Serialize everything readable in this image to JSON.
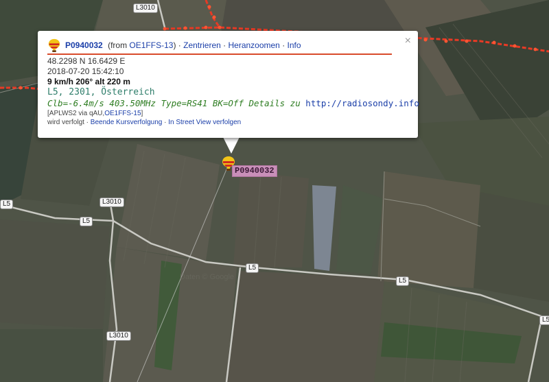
{
  "map": {
    "road_labels": [
      "L3010",
      "L5",
      "L3010",
      "L5",
      "L5",
      "L5",
      "L3010",
      "L5",
      "L5"
    ],
    "watermark": "Daten © Google"
  },
  "marker": {
    "label": "P0940032"
  },
  "popup": {
    "callsign": "P0940032",
    "from_prefix": " (from ",
    "from_call": "OE1FFS-13",
    "from_suffix": ")",
    "sep": " · ",
    "links": [
      "Zentrieren",
      "Heranzoomen",
      "Info"
    ],
    "coords": "48.2298 N 16.6429 E",
    "timestamp": "2018-07-20 15:42:10",
    "speed": "9 km/h 206° alt 220 m",
    "location": "L5, 2301, Österreich",
    "comment_text": "Clb=-6.4m/s 403.50MHz Type=RS41 BK=Off Details zu ",
    "comment_url": "http://radiosondy.info",
    "path_prefix": "[APLWS2 via qAU,",
    "path_call": "OE1FFS-15",
    "path_suffix": "]",
    "tracked_text": "wird verfolgt · ",
    "stop_tracking": "Beende Kursverfolgung",
    "streetview": "In Street View verfolgen",
    "close_symbol": "×"
  },
  "colors": {
    "track": "#e83a25",
    "link": "#1a3ea8",
    "comment": "#2e7d22",
    "marker_label_bg": "#c98fb9"
  }
}
